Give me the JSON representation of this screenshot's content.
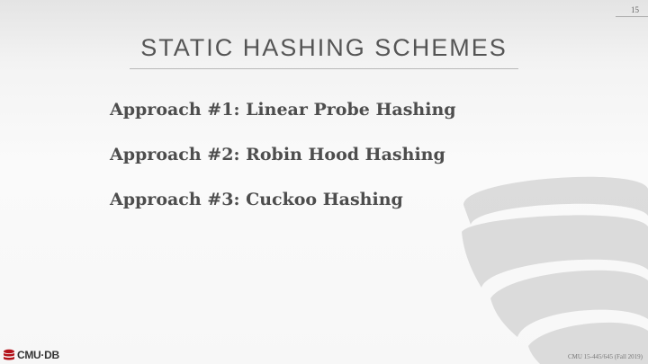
{
  "slide": {
    "number": "15",
    "title": "STATIC HASHING SCHEMES",
    "bullets": [
      "Approach #1: Linear Probe Hashing",
      "Approach #2: Robin Hood Hashing",
      "Approach #3: Cuckoo Hashing"
    ]
  },
  "footer": {
    "logo_text": "CMU·DB",
    "course": "CMU 15-445/645 (Fall 2019)"
  },
  "colors": {
    "logo_red": "#b3121a",
    "title_gray": "#555555",
    "text_gray": "#4d4d4d"
  },
  "icons": {
    "watermark": "database-cylinder-icon",
    "logo": "database-icon"
  }
}
